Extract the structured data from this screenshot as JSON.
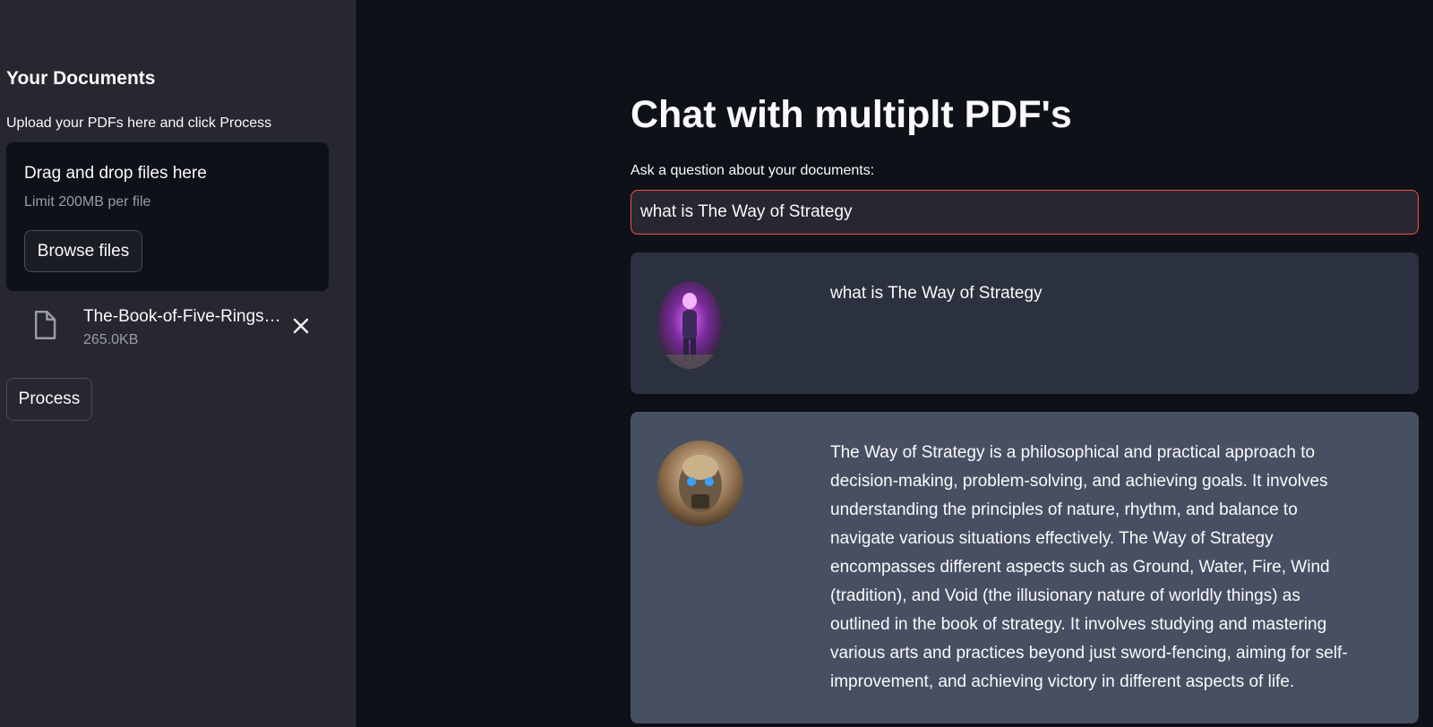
{
  "sidebar": {
    "heading": "Your Documents",
    "instructions": "Upload your PDFs here and click Process",
    "dropzone": {
      "title": "Drag and drop files here",
      "limit": "Limit 200MB per file",
      "browse_label": "Browse files"
    },
    "file": {
      "name": "The-Book-of-Five-Rings-…",
      "size": "265.0KB"
    },
    "process_label": "Process"
  },
  "main": {
    "title": "Chat with multiplt PDF's",
    "ask_label": "Ask a question about your documents:",
    "question_value": "what is The Way of Strategy",
    "messages": [
      {
        "role": "user",
        "text": "what is The Way of Strategy"
      },
      {
        "role": "bot",
        "text": "The Way of Strategy is a philosophical and practical approach to decision-making, problem-solving, and achieving goals. It involves understanding the principles of nature, rhythm, and balance to navigate various situations effectively. The Way of Strategy encompasses different aspects such as Ground, Water, Fire, Wind (tradition), and Void (the illusionary nature of worldly things) as outlined in the book of strategy. It involves studying and mastering various arts and practices beyond just sword-fencing, aiming for self-improvement, and achieving victory in different aspects of life."
      }
    ]
  },
  "colors": {
    "background": "#0e1117",
    "sidebar": "#262730",
    "input_focus_border": "#ff4b4b",
    "user_message_bg": "#2b313e",
    "bot_message_bg": "#475063"
  },
  "icons": {
    "file": "file-icon",
    "remove": "close-icon"
  }
}
